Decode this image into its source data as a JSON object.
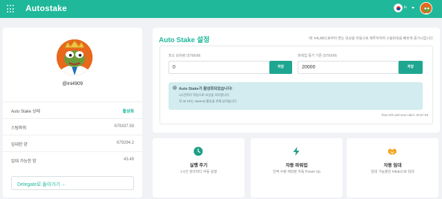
{
  "header": {
    "app_title": "Autostake",
    "language": "kr"
  },
  "profile": {
    "username": "@ini4909"
  },
  "stats": [
    {
      "label": "Auto Stake 상태",
      "value": "활성화",
      "status": true
    },
    {
      "label": "스팀파워",
      "value": "679337.59"
    },
    {
      "label": "임대한 양",
      "value": "679294.2"
    },
    {
      "label": "임대 가능한 양",
      "value": "43.49"
    }
  ],
  "back_button": {
    "label": "Delegate로 돌아가기 ←"
  },
  "settings": {
    "title": "Auto Stake 설정",
    "description": "예: h4LAB으로부터 받는 보상을 자동으로 재투자하여 스팀파워를 빠르게 증가시킵니다.",
    "min_hold": {
      "label": "최소 보유량 (STEEM)",
      "value": "0",
      "button": "저장"
    },
    "threshold": {
      "label": "파워업 증가 기준 (STEEM)",
      "value": "20000",
      "button": "저장"
    },
    "info": {
      "title": "Auto Stake가 활성화되었습니다!",
      "line1": "1시간마다 자동으로 보상을 처리합니다.",
      "line2": "약 40 SP는 Steemit 활동을 위해 남겨둡니다."
    },
    "time_left": "Time left until next claim: 00:57:59"
  },
  "features": [
    {
      "icon": "clock-icon",
      "title": "실행 주기",
      "desc": "1시간 창리마다 자동 실행"
    },
    {
      "icon": "bolt-icon",
      "title": "자동 파워업",
      "desc": "잔액 수량 제외분 자동 Power Up"
    },
    {
      "icon": "handshake-icon",
      "title": "자동 임대",
      "desc": "임대 가능분은 h4lab으로 임대"
    }
  ],
  "colors": {
    "brand": "#1fb89a",
    "accent_orange": "#f5a623"
  }
}
